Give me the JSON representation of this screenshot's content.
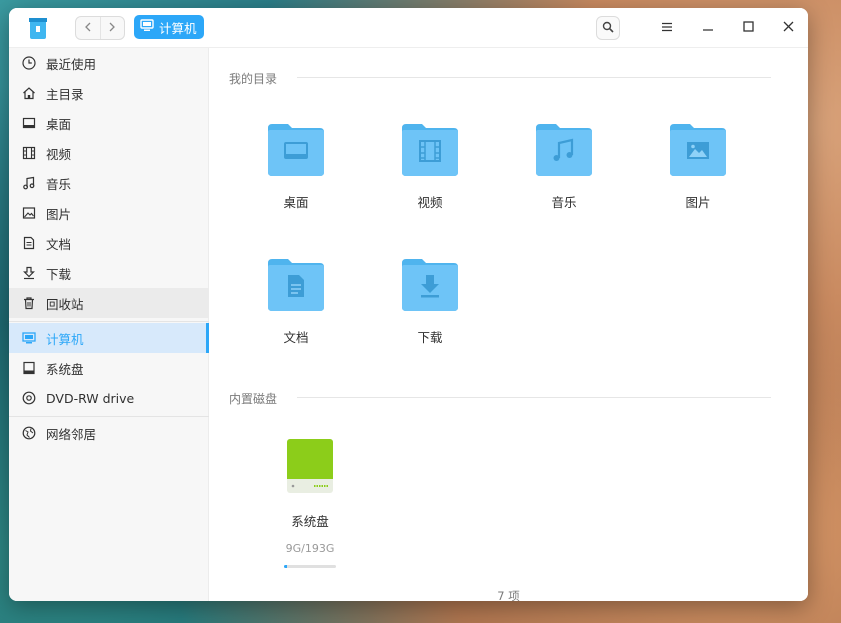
{
  "window": {
    "breadcrumb": "计算机"
  },
  "sidebar": {
    "items": [
      {
        "label": "最近使用",
        "icon": "clock-icon"
      },
      {
        "label": "主目录",
        "icon": "home-icon"
      },
      {
        "label": "桌面",
        "icon": "desktop-icon"
      },
      {
        "label": "视频",
        "icon": "film-icon"
      },
      {
        "label": "音乐",
        "icon": "music-icon"
      },
      {
        "label": "图片",
        "icon": "image-icon"
      },
      {
        "label": "文档",
        "icon": "document-icon"
      },
      {
        "label": "下载",
        "icon": "download-icon"
      },
      {
        "label": "回收站",
        "icon": "trash-icon"
      },
      {
        "label": "计算机",
        "icon": "computer-icon"
      },
      {
        "label": "系统盘",
        "icon": "disk-icon"
      },
      {
        "label": "DVD-RW drive",
        "icon": "disc-icon"
      },
      {
        "label": "网络邻居",
        "icon": "network-icon"
      }
    ]
  },
  "main": {
    "my_dirs_title": "我的目录",
    "folders": [
      {
        "label": "桌面",
        "icon": "desktop-folder-icon"
      },
      {
        "label": "视频",
        "icon": "video-folder-icon"
      },
      {
        "label": "音乐",
        "icon": "music-folder-icon"
      },
      {
        "label": "图片",
        "icon": "picture-folder-icon"
      },
      {
        "label": "文档",
        "icon": "document-folder-icon"
      },
      {
        "label": "下载",
        "icon": "download-folder-icon"
      }
    ],
    "disks_title": "内置磁盘",
    "disk": {
      "name": "系统盘",
      "usage": "9G/193G",
      "used_fraction": 0.05
    },
    "status": "7 项"
  },
  "colors": {
    "accent": "#2ca7f8",
    "folder": "#6ec4f7",
    "disk": "#8ccd1a"
  }
}
